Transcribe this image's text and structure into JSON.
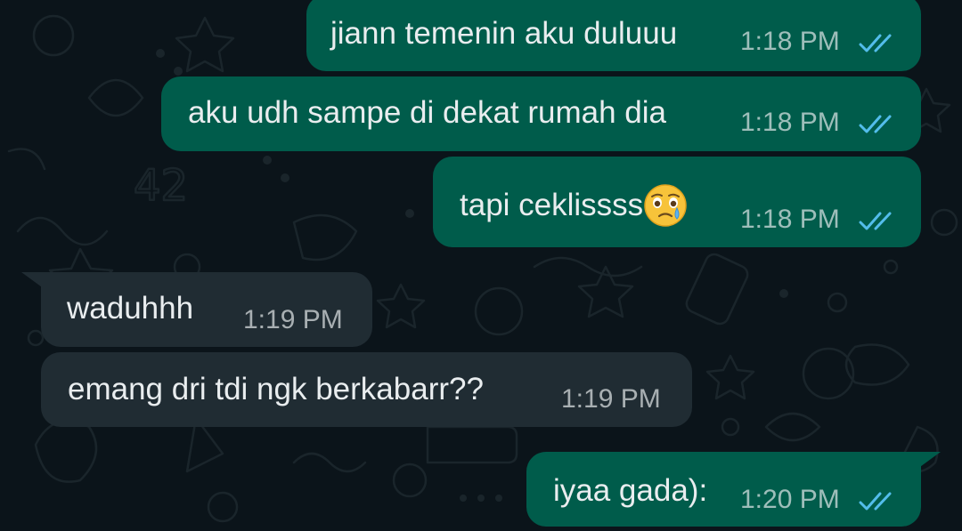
{
  "colors": {
    "background": "#0b141a",
    "outgoing_bubble": "#005c4b",
    "incoming_bubble": "#202c33",
    "message_text": "#e9edef",
    "read_receipt": "#53bdeb"
  },
  "messages": [
    {
      "direction": "outgoing",
      "text": "jiann temenin aku duluuu",
      "time": "1:18 PM",
      "status": "read"
    },
    {
      "direction": "outgoing",
      "text": "aku udh sampe di dekat rumah dia",
      "time": "1:18 PM",
      "status": "read"
    },
    {
      "direction": "outgoing",
      "text": "tapi ceklissss",
      "emoji": "face-holding-back-tears-icon",
      "time": "1:18 PM",
      "status": "read"
    },
    {
      "direction": "incoming",
      "text": "waduhhh",
      "time": "1:19 PM"
    },
    {
      "direction": "incoming",
      "text": "emang dri tdi ngk berkabarr??",
      "time": "1:19 PM"
    },
    {
      "direction": "outgoing",
      "text": "iyaa gada):",
      "time": "1:20 PM",
      "status": "read"
    }
  ]
}
